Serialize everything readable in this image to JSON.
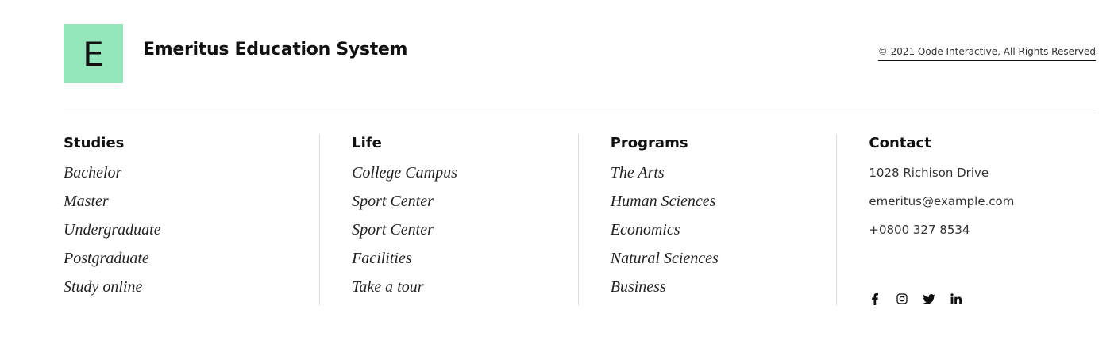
{
  "brand": {
    "logo_letter": "E",
    "name": "Emeritus Education System",
    "accent_color": "#92e6b9"
  },
  "copyright": "© 2021 Qode Interactive, All Rights Reserved",
  "columns": {
    "studies": {
      "title": "Studies",
      "items": [
        "Bachelor",
        "Master",
        "Undergraduate",
        "Postgraduate",
        "Study online"
      ]
    },
    "life": {
      "title": "Life",
      "items": [
        "College Campus",
        "Sport Center",
        "Sport Center",
        "Facilities",
        "Take a tour"
      ]
    },
    "programs": {
      "title": "Programs",
      "items": [
        "The Arts",
        "Human Sciences",
        "Economics",
        "Natural Sciences",
        "Business"
      ]
    },
    "contact": {
      "title": "Contact",
      "address": "1028 Richison Drive",
      "email": "emeritus@example.com",
      "phone": "+0800 327 8534",
      "social_icons": [
        "facebook-icon",
        "instagram-icon",
        "twitter-icon",
        "linkedin-icon"
      ]
    }
  }
}
